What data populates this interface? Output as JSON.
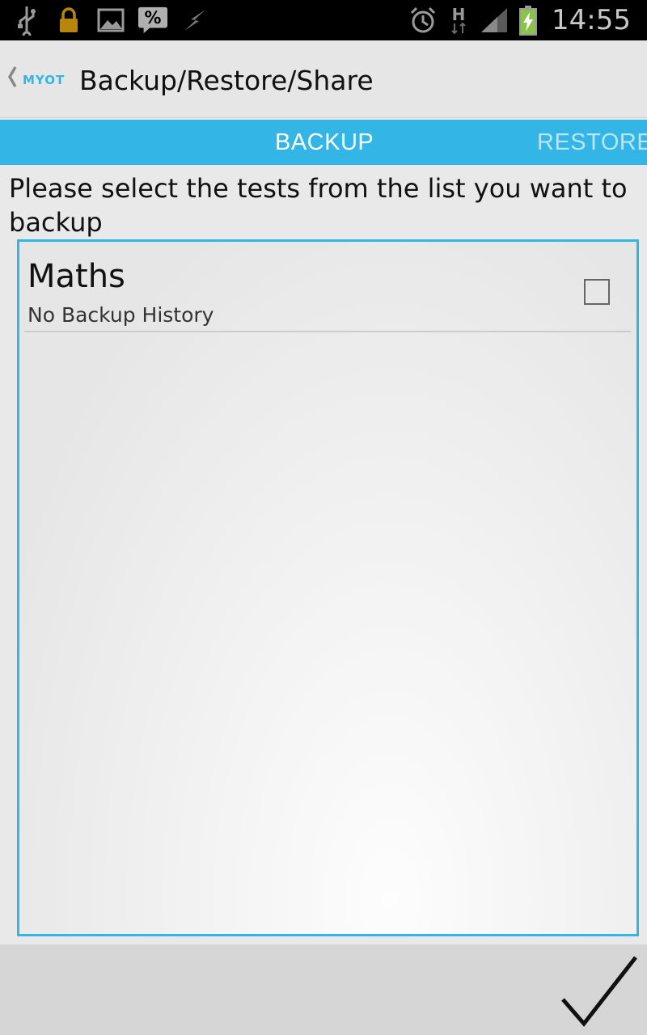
{
  "status_bar": {
    "time": "14:55",
    "network_type": "H",
    "icons": [
      "usb-icon",
      "lock-icon",
      "image-icon",
      "percent-icon",
      "flash-icon",
      "alarm-icon",
      "network-h-icon",
      "signal-icon",
      "battery-charging-icon"
    ]
  },
  "action_bar": {
    "logo_text": "MYOT",
    "title": "Backup/Restore/Share"
  },
  "tabs": [
    {
      "label": "BACKUP",
      "selected": true
    },
    {
      "label": "RESTORE",
      "selected": false
    }
  ],
  "instruction": "Please select the tests from the list you want to backup",
  "list": {
    "items": [
      {
        "title": "Maths",
        "subtitle": "No Backup History",
        "checked": false
      }
    ]
  },
  "colors": {
    "accent": "#33b5e5",
    "status_bar_bg": "#000000",
    "battery_green": "#8bc34a"
  },
  "bottom_bar": {
    "confirm_icon": "checkmark-icon"
  }
}
